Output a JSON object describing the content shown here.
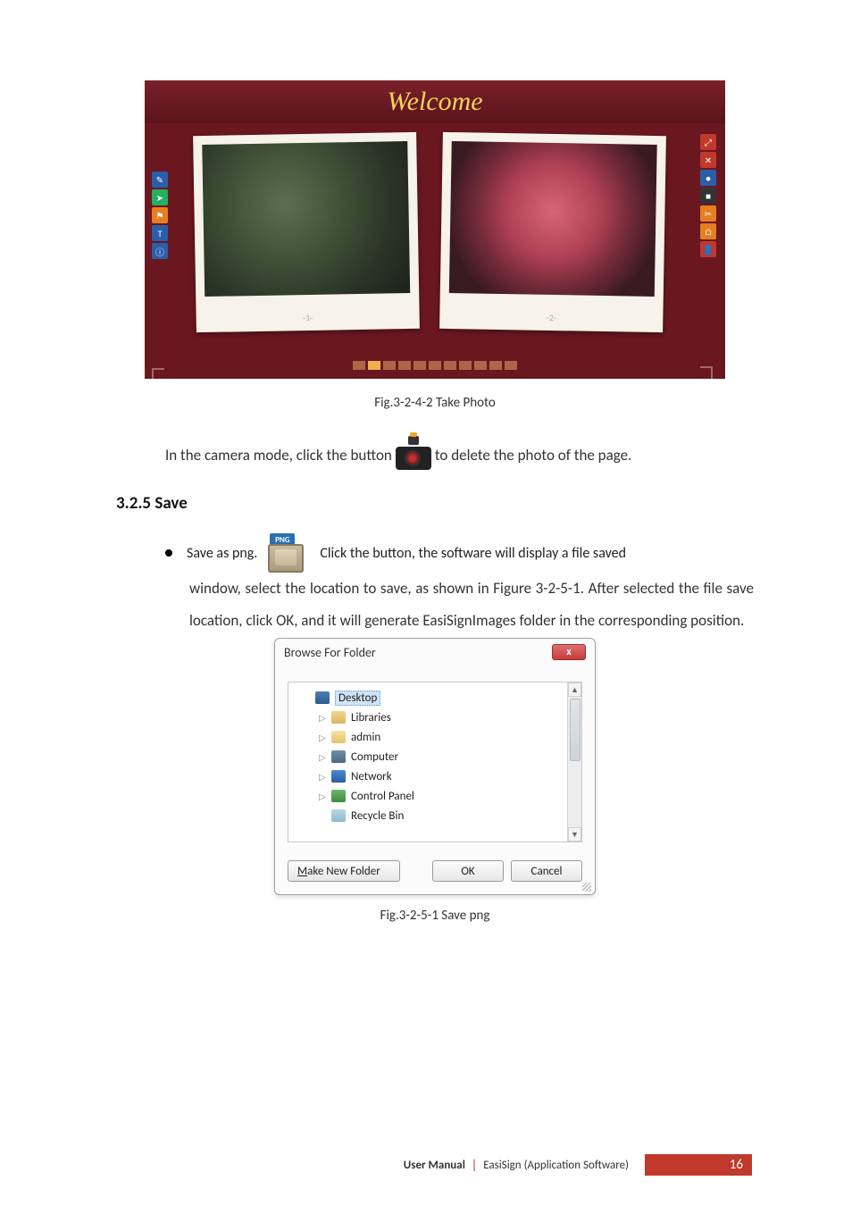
{
  "banner": {
    "title": "Welcome",
    "left_tick": "-1-",
    "right_tick": "-2-",
    "thumb_count": 11
  },
  "caption_take_photo": "Fig.3-2-4-2 Take Photo",
  "para_camera_before": "In the camera mode, click the button",
  "para_camera_after": "to delete the photo of the page.",
  "section_save": "3.2.5 Save",
  "bullet_save_label": "Save as png.",
  "bullet_save_rest": "Click the button, the software will display a file saved",
  "body_para_lines": "window, select the location to save, as shown in Figure 3-2-5-1. After selected the file save location, click OK, and it will generate EasiSignImages folder in the corresponding position.",
  "dialog": {
    "title": "Browse For Folder",
    "close": "x",
    "items": [
      {
        "label": "Desktop",
        "icon": "desktop",
        "selected": true,
        "child": false,
        "arrow": ""
      },
      {
        "label": "Libraries",
        "icon": "lib",
        "selected": false,
        "child": true,
        "arrow": "▷"
      },
      {
        "label": "admin",
        "icon": "user",
        "selected": false,
        "child": true,
        "arrow": "▷"
      },
      {
        "label": "Computer",
        "icon": "computer",
        "selected": false,
        "child": true,
        "arrow": "▷"
      },
      {
        "label": "Network",
        "icon": "network",
        "selected": false,
        "child": true,
        "arrow": "▷"
      },
      {
        "label": "Control Panel",
        "icon": "cpanel",
        "selected": false,
        "child": true,
        "arrow": "▷"
      },
      {
        "label": "Recycle Bin",
        "icon": "recycle",
        "selected": false,
        "child": true,
        "arrow": ""
      }
    ],
    "buttons": {
      "make_prefix": "M",
      "make_rest": "ake New Folder",
      "ok": "OK",
      "cancel": "Cancel"
    },
    "png_tab": "PNG"
  },
  "caption_save_png": "Fig.3-2-5-1 Save png",
  "footer": {
    "bold": "User Manual",
    "rest": "EasiSign (Application Software)",
    "page": "16"
  }
}
